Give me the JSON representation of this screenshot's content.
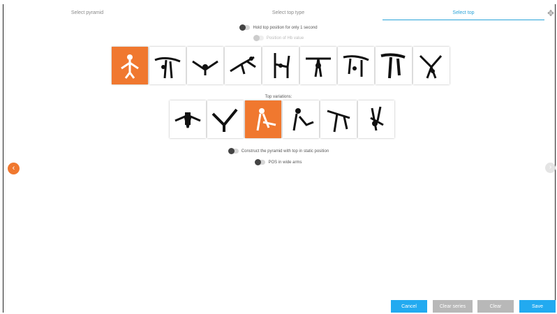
{
  "tabs": [
    {
      "label": "Select pyramid",
      "active": false
    },
    {
      "label": "Select top type",
      "active": false
    },
    {
      "label": "Select top",
      "active": true
    }
  ],
  "toggles": {
    "hold_top": {
      "label": "Hold top position for only 1 second",
      "on": false
    },
    "position_hb": {
      "label": "Position of Hb value",
      "disabled": true
    },
    "construct_static": {
      "label": "Construct the pyramid with top in static position",
      "on": false
    },
    "pos_wide_arms": {
      "label": "POS in wide arms",
      "on": false
    }
  },
  "top_types": {
    "selected_index": 0,
    "items": [
      "top-pose-1",
      "top-pose-2",
      "top-pose-3",
      "top-pose-4",
      "top-pose-5",
      "top-pose-6",
      "top-pose-7",
      "top-pose-8",
      "top-pose-9"
    ]
  },
  "variations": {
    "label": "Top variations:",
    "selected_index": 2,
    "items": [
      "variation-1",
      "variation-2",
      "variation-3",
      "variation-4",
      "variation-5",
      "variation-6"
    ]
  },
  "nav": {
    "prev_icon": "chevron-left",
    "next_icon": "chevron-right"
  },
  "footer": {
    "cancel": "Cancel",
    "clear_series": "Clear series",
    "clear": "Clear",
    "save": "Save"
  },
  "colors": {
    "accent": "#f0782f",
    "primary": "#22aaf0",
    "grey_button": "#b8b8b8",
    "tab_active": "#2aa3d8"
  }
}
